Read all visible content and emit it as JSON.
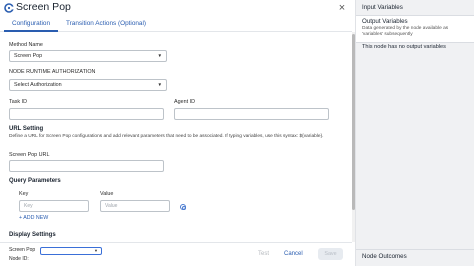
{
  "header": {
    "title": "Screen Pop",
    "close_symbol": "×"
  },
  "tabs": [
    {
      "label": "Configuration",
      "active": true
    },
    {
      "label": "Transition Actions (Optional)",
      "active": false
    }
  ],
  "form": {
    "method_name": {
      "label": "Method Name",
      "value": "Screen Pop"
    },
    "runtime_auth": {
      "label": "NODE RUNTIME AUTHORIZATION",
      "value": "Select Authorization"
    },
    "task_id": {
      "label": "Task ID",
      "value": ""
    },
    "agent_id": {
      "label": "Agent ID",
      "value": ""
    },
    "url_setting": {
      "title": "URL Setting",
      "helper": "Define a URL for Screen Pop configurations and add relevant parameters that need to be associated. If typing variables, use this syntax: ${variable}.",
      "screen_pop_url_label": "Screen Pop URL",
      "screen_pop_url_value": ""
    },
    "query_parameters": {
      "title": "Query Parameters",
      "key_header": "Key",
      "value_header": "Value",
      "key_placeholder": "Key",
      "value_placeholder": "Value",
      "add_new": "+ ADD NEW"
    },
    "display_settings": {
      "title": "Display Settings",
      "screen_pop_label": "Screen Pop",
      "node_id_label": "Node ID:"
    }
  },
  "footer": {
    "test": "Test",
    "cancel": "Cancel",
    "save": "Save"
  },
  "right_panel": {
    "input_variables": "Input Variables",
    "output_variables": "Output Variables",
    "output_desc": "Data generated by the node available as 'variables' subsequently",
    "no_output": "This node has no output variables",
    "node_outcomes": "Node Outcomes"
  },
  "colors": {
    "accent": "#2a5db0",
    "panel_bg": "#f0f1f3"
  }
}
